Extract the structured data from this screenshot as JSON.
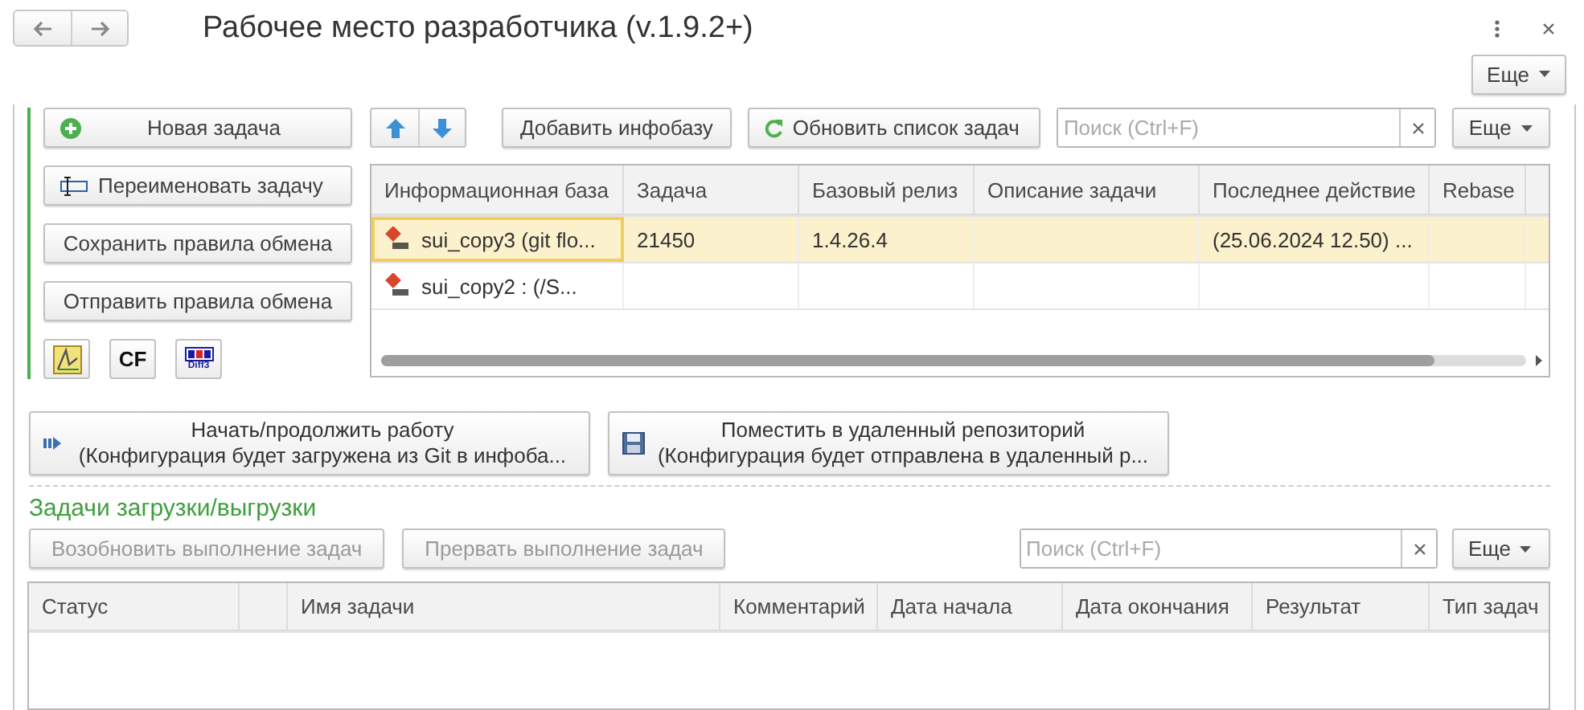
{
  "window": {
    "title": "Рабочее место разработчика (v.1.9.2+)",
    "more_button": "Еще"
  },
  "left_buttons": [
    {
      "kind": "add",
      "label": "Новая задача"
    },
    {
      "kind": "rename",
      "label": "Переименовать задачу"
    },
    {
      "kind": "plain",
      "label": "Сохранить правила обмена"
    },
    {
      "kind": "plain",
      "label": "Отправить правила обмена"
    }
  ],
  "tool_icons": [
    {
      "kind": "chart"
    },
    {
      "kind": "cf",
      "label": "CF"
    },
    {
      "kind": "diff",
      "label": "Diff3"
    }
  ],
  "infobase_toolbar": {
    "add_button": "Добавить инфобазу",
    "refresh_button": "Обновить список задач",
    "search": {
      "placeholder": "Поиск (Ctrl+F)"
    },
    "more_button": "Еще"
  },
  "infobase_table": {
    "columns": [
      "Информационная база",
      "Задача",
      "Базовый релиз",
      "Описание задачи",
      "Последнее действие",
      "Rebase",
      ""
    ],
    "rows": [
      {
        "selected": true,
        "cells": [
          "sui_copy3 (git flo...",
          "21450",
          "1.4.26.4",
          "",
          "(25.06.2024 12.50) ...",
          "",
          ""
        ]
      },
      {
        "selected": false,
        "cells": [
          "sui_copy2 :   (/S...",
          "",
          "",
          "",
          "",
          "",
          ""
        ]
      }
    ]
  },
  "action_buttons": [
    {
      "kind": "start",
      "title": "Начать/продолжить работу",
      "subtitle": "(Конфигурация будет загружена из Git в инфоба..."
    },
    {
      "kind": "save",
      "title": "Поместить в удаленный репозиторий",
      "subtitle": "(Конфигурация будет отправлена в удаленный р..."
    }
  ],
  "jobs": {
    "title": "Задачи загрузки/выгрузки",
    "buttons": [
      {
        "label": "Возобновить выполнение задач",
        "disabled": true
      },
      {
        "label": "Прервать выполнение задач",
        "disabled": true
      }
    ],
    "search": {
      "placeholder": "Поиск (Ctrl+F)"
    },
    "more_button": "Еще",
    "columns": [
      "Статус",
      "",
      "Имя задачи",
      "Комментарий",
      "Дата начала",
      "Дата окончания",
      "Результат",
      "Тип задач"
    ]
  }
}
